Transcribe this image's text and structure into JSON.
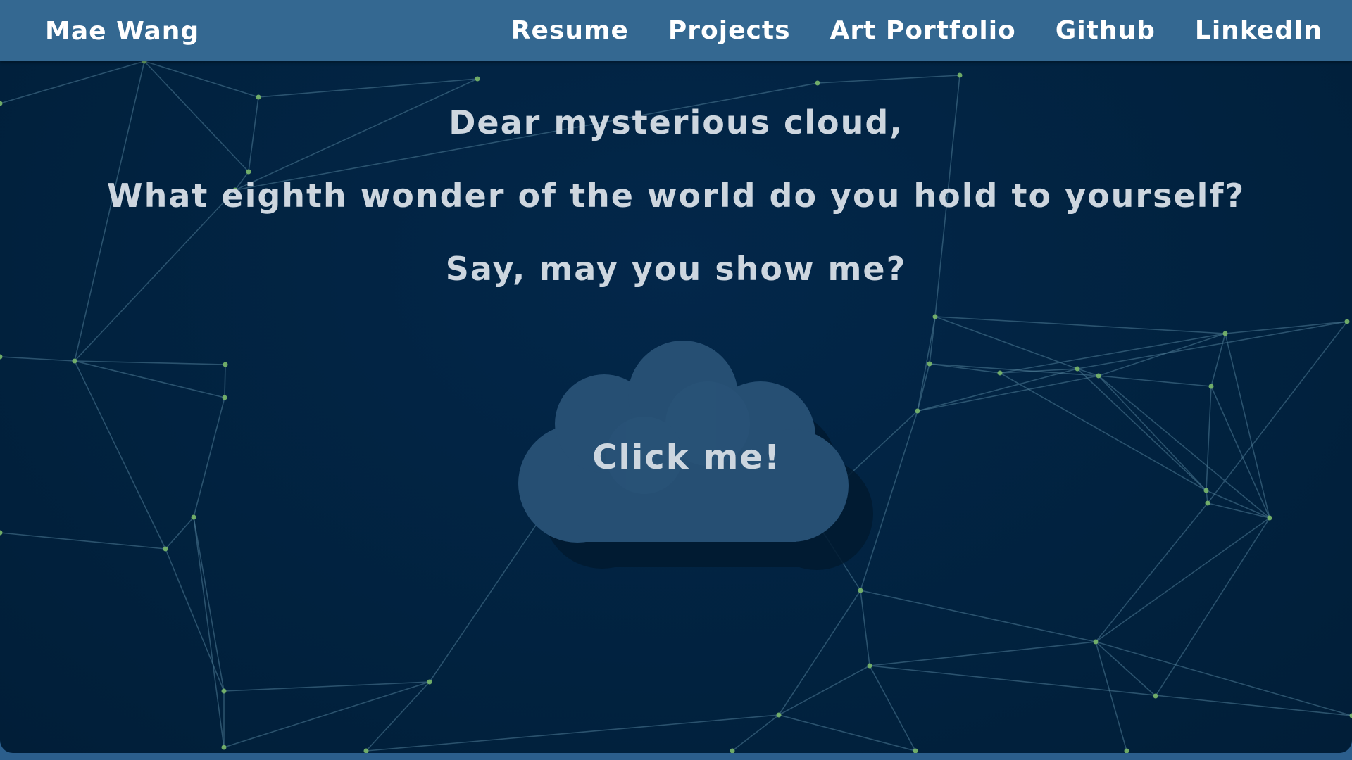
{
  "nav": {
    "brand": "Mae Wang",
    "links": [
      {
        "label": "Resume"
      },
      {
        "label": "Projects"
      },
      {
        "label": "Art Portfolio"
      },
      {
        "label": "Github"
      },
      {
        "label": "LinkedIn"
      }
    ]
  },
  "hero": {
    "line1": "Dear mysterious cloud,",
    "line2": "What eighth wonder of the world do you hold to yourself?",
    "line3": "Say, may you show me?"
  },
  "cloud_button": {
    "label": "Click me!"
  },
  "colors": {
    "navbar": "#346891",
    "background": "#01223f",
    "text": "#cdd6df",
    "cloud": "#264f73",
    "network_line": "#4f7b96",
    "network_node": "#7ab86a"
  }
}
